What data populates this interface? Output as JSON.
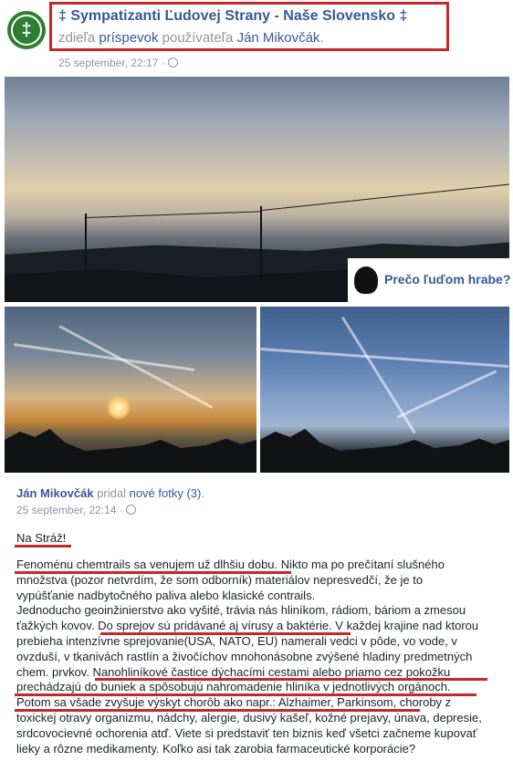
{
  "share": {
    "page_name": "‡ Sympatizanti Ľudovej Strany - Naše Slovensko ‡",
    "shares_text": "zdieľa",
    "post_link": "príspevok",
    "user_text": "používateľa",
    "user_name": "Ján Mikovčák",
    "period": ".",
    "timestamp": "25 september, 22:17 ·"
  },
  "promo": {
    "text": "Prečo ľuďom hrabe?"
  },
  "post": {
    "author": "Ján Mikovčák",
    "action": "pridal",
    "photos_link": "nové fotky (3)",
    "period": ".",
    "timestamp": "25 september, 22:14 ·",
    "heading": "Na Stráž!",
    "lines": [
      "Fenoménu chemtrails sa venujem už dlhšiu dobu. Nikto ma po prečítaní slušného",
      "množstva (pozor netvrdím, že som odborník) materiálov nepresvedčí, že je to",
      "vypúšťanie nadbytočného paliva alebo klasické contrails.",
      "Jednoducho geoinžinierstvo ako vyšité, trávia nás hliníkom, rádiom, báriom a zmesou",
      "ťažkých kovov. Do sprejov sú pridávané aj vírusy a baktérie. V každej krajine nad ktorou",
      "prebieha intenzívne sprejovanie(USA, NATO, EU) namerali vedci v pôde, vo vode, v",
      "ovzduší, v tkanivách rastlín a živočíchov mnohonásobne zvýšené hladiny predmetných",
      "chem. prvkov. Nanohliníkové častice dýchacími cestami alebo priamo cez pokožku",
      "prechádzajú do buniek a spôsobujú nahromadenie hliníka v jednotlivých orgánoch.",
      "Potom sa všade zvyšuje výskyt chorôb ako napr.: Alzhaimer, Parkinsom, choroby z",
      "toxickej otravy organizmu, nádchy, alergie, dusivý kašeľ, kožné prejavy, únava, depresie,",
      "srdcovocievné ochorenia atď. Viete si predstaviť ten biznis keď všetci začneme kupovať",
      "lieky a rôzne medikamenty. Koľko asi tak zarobia farmaceutické korporácie?"
    ]
  },
  "colors": {
    "link": "#365899",
    "meta": "#90949c",
    "highlight": "#c62828",
    "avatar": "#2e7d32"
  }
}
